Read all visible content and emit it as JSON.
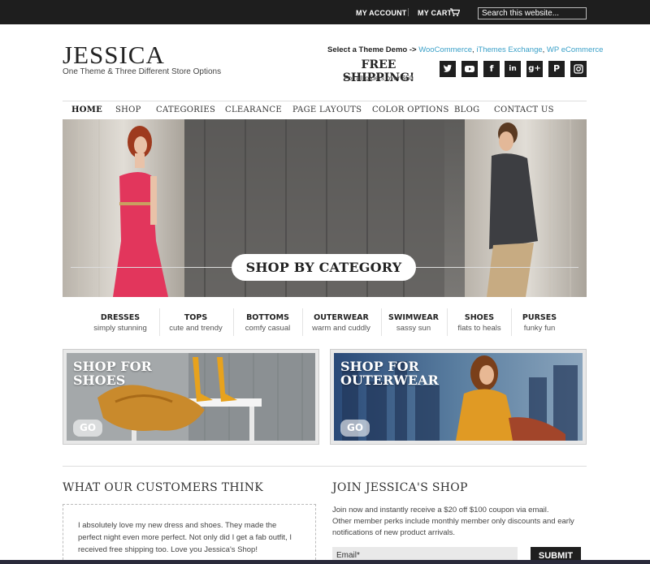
{
  "topbar": {
    "my_account": "MY ACCOUNT",
    "my_cart": "MY CART",
    "search_placeholder": "Search this website..."
  },
  "header": {
    "logo": "JESSICA",
    "tagline": "One Theme & Three Different Store Options",
    "demo_label": "Select a Theme Demo ->",
    "demo_links": [
      "WooCommerce",
      "iThemes Exchange",
      "WP eCommerce"
    ],
    "free_shipping": "FREE SHIPPING!",
    "free_shipping_sub": "For all orders over $50",
    "social_icons": [
      "twitter-icon",
      "youtube-icon",
      "facebook-icon",
      "linkedin-icon",
      "google-plus-icon",
      "pinterest-icon",
      "instagram-icon"
    ]
  },
  "nav": {
    "items": [
      "HOME",
      "SHOP",
      "CATEGORIES",
      "CLEARANCE",
      "PAGE LAYOUTS",
      "COLOR OPTIONS",
      "BLOG",
      "CONTACT US"
    ],
    "active": "HOME"
  },
  "hero": {
    "button": "SHOP BY CATEGORY"
  },
  "categories": [
    {
      "title": "DRESSES",
      "sub": "simply stunning"
    },
    {
      "title": "TOPS",
      "sub": "cute and trendy"
    },
    {
      "title": "BOTTOMS",
      "sub": "comfy casual"
    },
    {
      "title": "OUTERWEAR",
      "sub": "warm and cuddly"
    },
    {
      "title": "SWIMWEAR",
      "sub": "sassy sun"
    },
    {
      "title": "SHOES",
      "sub": "flats to heals"
    },
    {
      "title": "PURSES",
      "sub": "funky fun"
    }
  ],
  "promos": [
    {
      "line1": "SHOP FOR",
      "line2": "SHOES",
      "go": "GO"
    },
    {
      "line1": "SHOP FOR",
      "line2": "OUTERWEAR",
      "go": "GO"
    }
  ],
  "testimonials": {
    "heading": "WHAT OUR CUSTOMERS THINK",
    "quote": "I absolutely love my new dress and shoes. They made the perfect night even more perfect. Not only did I get a fab outfit, I received free shipping too. Love you Jessica's Shop!"
  },
  "join": {
    "heading": "JOIN JESSICA'S SHOP",
    "line1": "Join now and instantly receive a $20 off $100 coupon via email.",
    "line2": "Other member perks include monthly member only discounts and early notifications of new product arrivals.",
    "email_placeholder": "Email*",
    "submit": "SUBMIT"
  },
  "colors": {
    "topbar": "#1e1e1e",
    "link": "#3aa0c8",
    "dark_button": "#1f1f1f"
  }
}
